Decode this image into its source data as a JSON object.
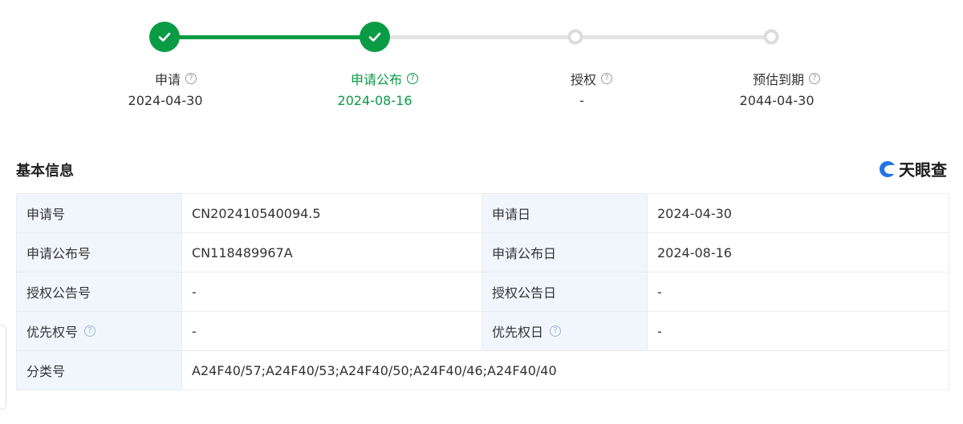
{
  "stepper": {
    "steps": [
      {
        "label": "申请",
        "date": "2024-04-30",
        "state": "done",
        "help_icon": "question-circle-icon"
      },
      {
        "label": "申请公布",
        "date": "2024-08-16",
        "state": "current",
        "help_icon": "question-circle-icon"
      },
      {
        "label": "授权",
        "date": "-",
        "state": "pending",
        "help_icon": "question-circle-icon"
      },
      {
        "label": "预估到期",
        "date": "2044-04-30",
        "state": "pending",
        "help_icon": "question-circle-icon"
      }
    ],
    "help_glyph": "?"
  },
  "section": {
    "title": "基本信息",
    "brand": "天眼查"
  },
  "info": {
    "rows": [
      {
        "k1": "申请号",
        "v1": "CN202410540094.5",
        "k2": "申请日",
        "v2": "2024-04-30"
      },
      {
        "k1": "申请公布号",
        "v1": "CN118489967A",
        "k2": "申请公布日",
        "v2": "2024-08-16"
      },
      {
        "k1": "授权公告号",
        "v1": "-",
        "k2": "授权公告日",
        "v2": "-"
      },
      {
        "k1": "优先权号",
        "v1": "-",
        "k2": "优先权日",
        "v2": "-"
      },
      {
        "k1": "分类号",
        "v1": "A24F40/57;A24F40/53;A24F40/50;A24F40/46;A24F40/40"
      }
    ]
  },
  "colors": {
    "accent_green": "#0a9b45",
    "key_cell_bg": "#f1f6fc",
    "brand_blue": "#1f74e8"
  }
}
